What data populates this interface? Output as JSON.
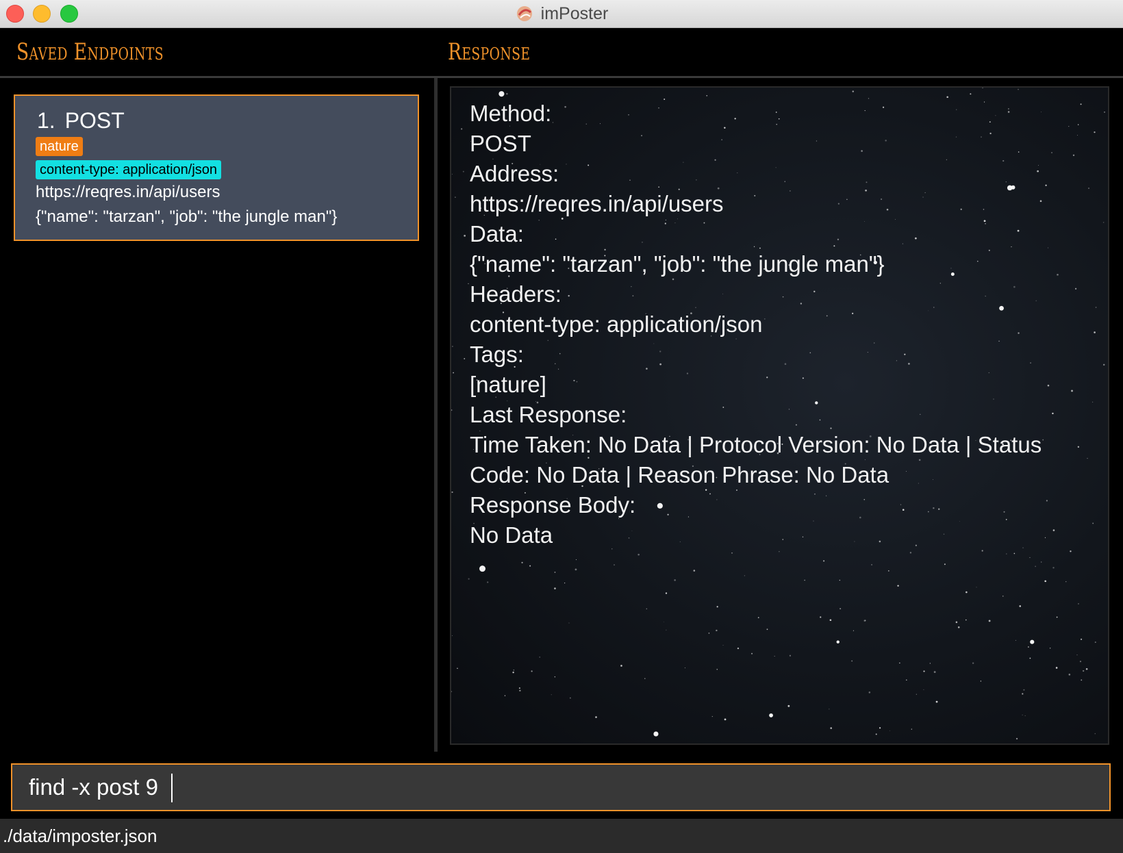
{
  "window": {
    "title": "imPoster"
  },
  "headers": {
    "left": "Saved Endpoints",
    "right": "Response"
  },
  "endpoints": [
    {
      "index": "1.",
      "method": "POST",
      "tag": "nature",
      "header": "content-type: application/json",
      "url": "https://reqres.in/api/users",
      "data": "{\"name\": \"tarzan\", \"job\": \"the jungle man\"}"
    }
  ],
  "response": {
    "lines": [
      "Method:",
      "POST",
      "Address:",
      "https://reqres.in/api/users",
      "Data:",
      "{\"name\": \"tarzan\", \"job\": \"the jungle man\"}",
      "Headers:",
      "content-type: application/json",
      "Tags:",
      "[nature]",
      "Last Response:",
      "Time Taken: No Data | Protocol Version: No Data | Status",
      "Code: No Data | Reason Phrase: No Data",
      "Response Body:",
      "No Data"
    ]
  },
  "command": {
    "value": "find -x post 9"
  },
  "status": {
    "path": "./data/imposter.json"
  },
  "colors": {
    "accent": "#f0922a",
    "card_bg": "#444c5c",
    "tag_orange": "#ef7d14",
    "tag_cyan": "#13e0e2"
  }
}
